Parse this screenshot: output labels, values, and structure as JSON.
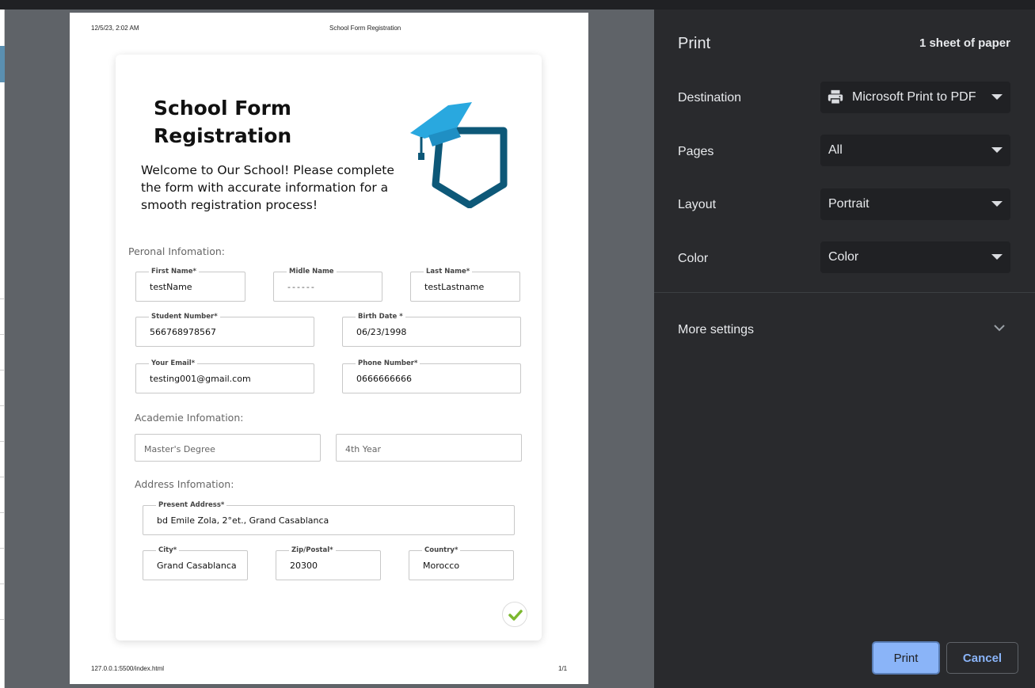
{
  "print_header": {
    "datetime": "12/5/23, 2:02 AM",
    "doc_title": "School Form Registration",
    "url": "127.0.0.1:5500/index.html",
    "page_count": "1/1"
  },
  "form": {
    "title_line1": "School Form",
    "title_line2": "Registration",
    "welcome": "Welcome to Our School! Please complete the form with accurate information for a smooth registration process!",
    "logo_icon": "graduation-cap-shield-icon",
    "sections": {
      "personal": "Peronal Infomation:",
      "academic": "Academie Infomation:",
      "address": "Address Infomation:"
    },
    "personal": {
      "first_name": {
        "label": "First Name*",
        "value": "testName"
      },
      "middle_name": {
        "label": "Midle Name",
        "value": "------"
      },
      "last_name": {
        "label": "Last Name*",
        "value": "testLastname"
      },
      "student_number": {
        "label": "Student Number*",
        "value": "566768978567"
      },
      "birth_date": {
        "label": "Birth Date *",
        "value": "06/23/1998"
      },
      "email": {
        "label": "Your Email*",
        "value": "testing001@gmail.com"
      },
      "phone": {
        "label": "Phone Number*",
        "value": "0666666666"
      }
    },
    "academic": {
      "degree": "Master's Degree",
      "year": "4th Year"
    },
    "address": {
      "present": {
        "label": "Present Address*",
        "value": "bd Emile Zola, 2°et., Grand Casablanca"
      },
      "city": {
        "label": "City*",
        "value": "Grand Casablanca"
      },
      "zip": {
        "label": "Zip/Postal*",
        "value": "20300"
      },
      "country": {
        "label": "Country*",
        "value": "Morocco"
      }
    },
    "submit_icon": "check-icon"
  },
  "print_panel": {
    "title": "Print",
    "sheets": "1 sheet of paper",
    "destination": {
      "label": "Destination",
      "value": "Microsoft Print to PDF",
      "icon": "printer-icon"
    },
    "pages": {
      "label": "Pages",
      "value": "All"
    },
    "layout": {
      "label": "Layout",
      "value": "Portrait"
    },
    "color": {
      "label": "Color",
      "value": "Color"
    },
    "more_settings": "More settings",
    "print_button": "Print",
    "cancel_button": "Cancel"
  },
  "colors": {
    "panel_bg": "#292a2d",
    "accent": "#8ab4f8",
    "logo_light": "#29a8df",
    "logo_dark": "#0d5878",
    "check": "#7cb82f"
  }
}
